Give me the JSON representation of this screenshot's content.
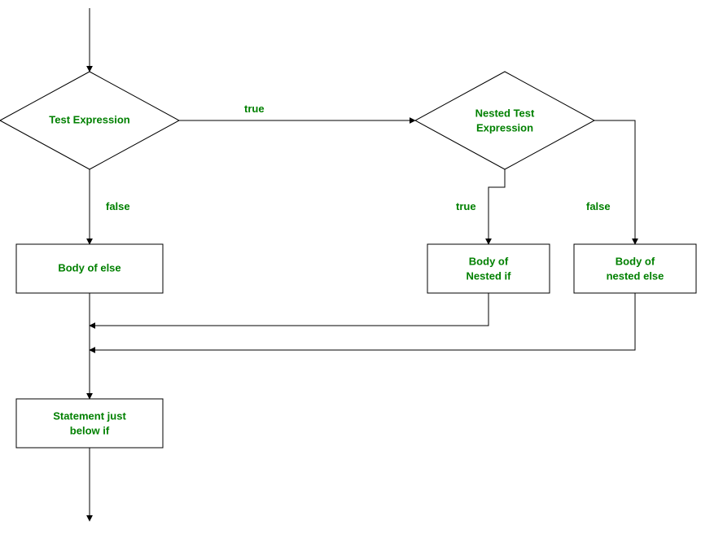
{
  "diagram": {
    "type": "flowchart",
    "nodes": {
      "testExpression": {
        "shape": "diamond",
        "label": "Test Expression"
      },
      "nestedTest": {
        "shape": "diamond",
        "label_l1": "Nested Test",
        "label_l2": "Expression"
      },
      "bodyElse": {
        "shape": "rect",
        "label": "Body of else"
      },
      "bodyNestedIf": {
        "shape": "rect",
        "label_l1": "Body of",
        "label_l2": "Nested if"
      },
      "bodyNestedElse": {
        "shape": "rect",
        "label_l1": "Body of",
        "label_l2": "nested else"
      },
      "statementBelow": {
        "shape": "rect",
        "label_l1": "Statement just",
        "label_l2": "below if"
      }
    },
    "edges": {
      "testExprTrue": "true",
      "testExprFalse": "false",
      "nestedTrue": "true",
      "nestedFalse": "false"
    }
  }
}
